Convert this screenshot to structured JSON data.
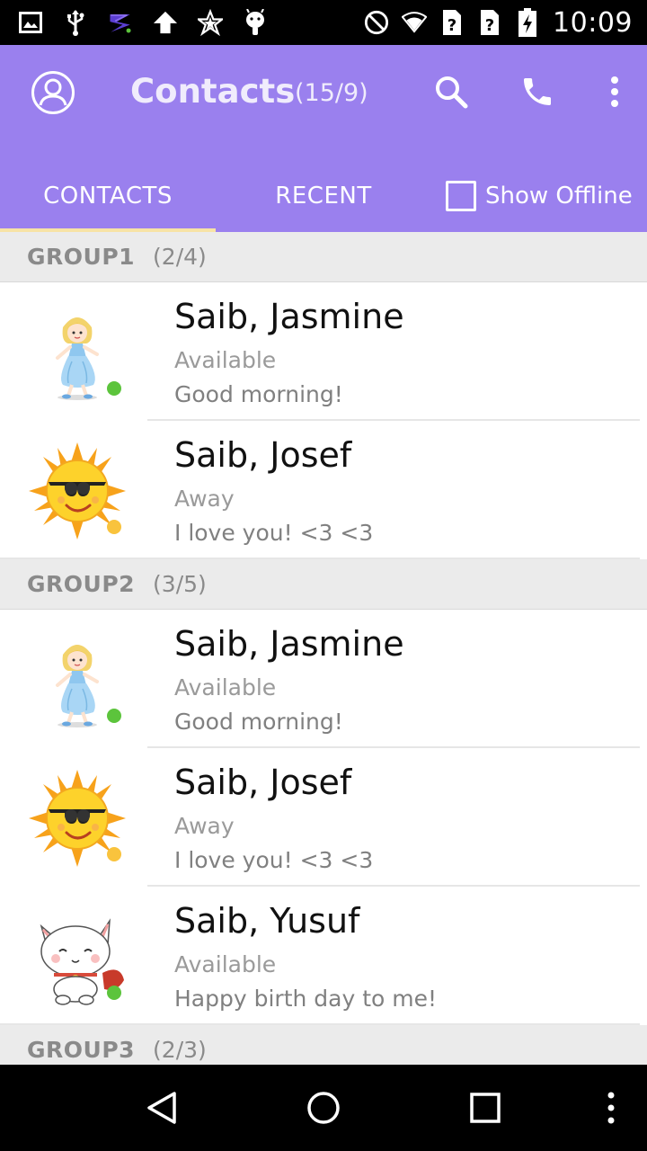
{
  "status_bar": {
    "time": "10:09",
    "left_icons": [
      "gallery-icon",
      "usb-icon",
      "app-s-icon",
      "upload-icon",
      "star-icon",
      "android-icon"
    ],
    "right_icons": [
      "do-not-disturb-icon",
      "wifi-icon",
      "sim1-unknown-icon",
      "sim2-unknown-icon",
      "battery-charging-icon"
    ]
  },
  "app_bar": {
    "title": "Contacts",
    "count": "(15/9)",
    "accent_color": "#9a80ee"
  },
  "tabs": [
    {
      "label": "CONTACTS",
      "selected": true
    },
    {
      "label": "RECENT",
      "selected": false
    }
  ],
  "show_offline": {
    "label": "Show Offline",
    "checked": false
  },
  "groups": [
    {
      "name": "GROUP1",
      "count": "(2/4)",
      "contacts": [
        {
          "name": "Saib, Jasmine",
          "status": "Available",
          "message": "Good morning!",
          "avatar": "princess",
          "status_color": "#5cc43c"
        },
        {
          "name": "Saib, Josef",
          "status": "Away",
          "message": "I love you! <3 <3",
          "avatar": "sun",
          "status_color": "#f9c33d"
        }
      ]
    },
    {
      "name": "GROUP2",
      "count": "(3/5)",
      "contacts": [
        {
          "name": "Saib, Jasmine",
          "status": "Available",
          "message": "Good morning!",
          "avatar": "princess",
          "status_color": "#5cc43c"
        },
        {
          "name": "Saib, Josef",
          "status": "Away",
          "message": "I love you! <3 <3",
          "avatar": "sun",
          "status_color": "#f9c33d"
        },
        {
          "name": "Saib, Yusuf",
          "status": "Available",
          "message": "Happy birth day to me!",
          "avatar": "cat",
          "status_color": "#5cc43c"
        }
      ]
    },
    {
      "name": "GROUP3",
      "count": "(2/3)",
      "contacts": []
    }
  ]
}
